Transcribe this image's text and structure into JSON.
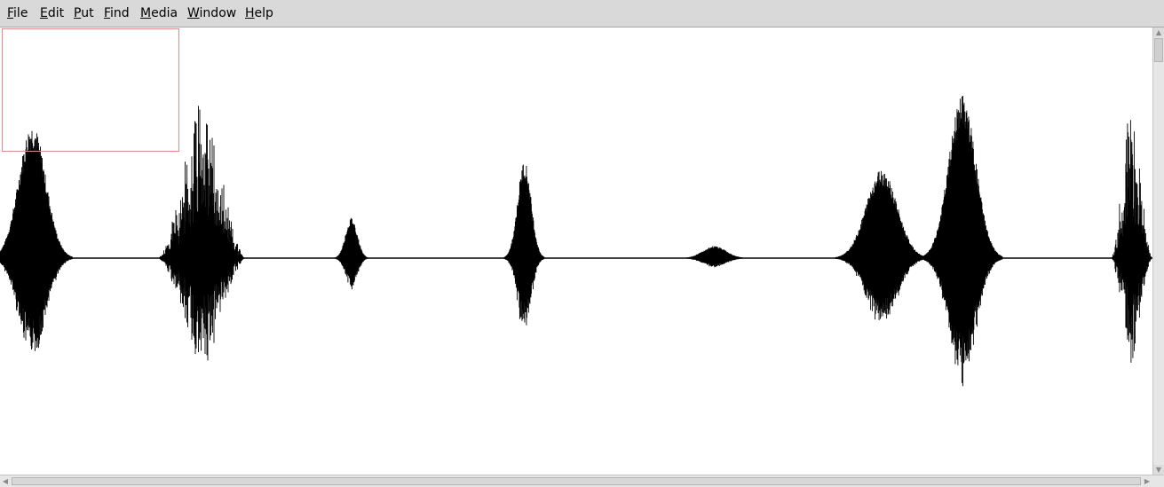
{
  "menubar": {
    "items": [
      {
        "mnemonic": "F",
        "rest": "ile"
      },
      {
        "mnemonic": "E",
        "rest": "dit"
      },
      {
        "mnemonic": "P",
        "rest": "ut"
      },
      {
        "mnemonic": "F",
        "rest": "ind"
      },
      {
        "mnemonic": "M",
        "rest": "edia"
      },
      {
        "mnemonic": "W",
        "rest": "indow"
      },
      {
        "mnemonic": "H",
        "rest": "elp"
      }
    ]
  },
  "waveform": {
    "color": "#000000",
    "bursts": [
      {
        "center": 0.028,
        "width": 0.07,
        "amplitude": 0.66,
        "shape": "bell"
      },
      {
        "center": 0.175,
        "width": 0.075,
        "amplitude": 0.88,
        "shape": "spiky"
      },
      {
        "center": 0.305,
        "width": 0.03,
        "amplitude": 0.2,
        "shape": "bell"
      },
      {
        "center": 0.455,
        "width": 0.035,
        "amplitude": 0.48,
        "shape": "bell"
      },
      {
        "center": 0.62,
        "width": 0.06,
        "amplitude": 0.06,
        "shape": "bell"
      },
      {
        "center": 0.765,
        "width": 0.08,
        "amplitude": 0.44,
        "shape": "bell"
      },
      {
        "center": 0.835,
        "width": 0.07,
        "amplitude": 0.8,
        "shape": "bell"
      },
      {
        "center": 0.982,
        "width": 0.035,
        "amplitude": 0.88,
        "shape": "spiky"
      }
    ]
  },
  "selection": {
    "color": "#e38a8a"
  }
}
